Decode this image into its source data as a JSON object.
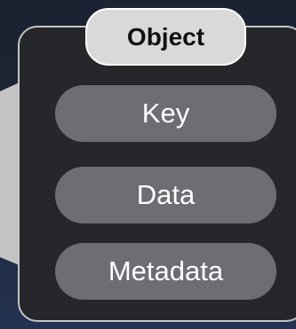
{
  "object": {
    "title": "Object",
    "fields": [
      {
        "label": "Key"
      },
      {
        "label": "Data"
      },
      {
        "label": "Metadata"
      }
    ]
  },
  "colors": {
    "background": "#1c2536",
    "box_fill": "#26272b",
    "box_border": "#c4c4c4",
    "title_fill": "#d9d9d9",
    "field_fill": "#6c6e73",
    "connector_fill": "#c3c3c3"
  }
}
